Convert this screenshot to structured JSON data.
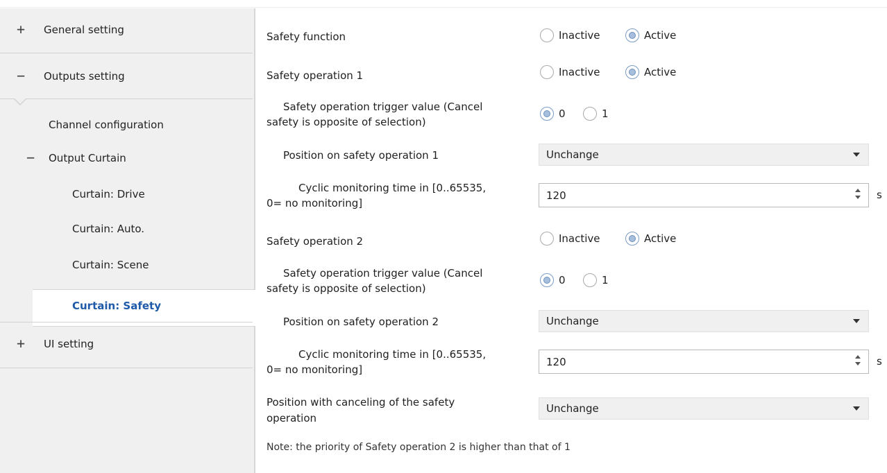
{
  "sidebar": {
    "items": [
      {
        "sign": "+",
        "label": "General setting"
      },
      {
        "sign": "−",
        "label": "Outputs setting"
      },
      {
        "label": "Channel configuration"
      },
      {
        "sign": "−",
        "label": "Output Curtain"
      },
      {
        "label": "Curtain: Drive"
      },
      {
        "label": "Curtain: Auto."
      },
      {
        "label": "Curtain: Scene"
      },
      {
        "label": "Curtain: Safety"
      },
      {
        "sign": "+",
        "label": "UI setting"
      }
    ]
  },
  "params": {
    "safety_function": {
      "label": "Safety function",
      "opt1": "Inactive",
      "opt2": "Active",
      "selected": "Active"
    },
    "safety_op1": {
      "label": "Safety operation 1",
      "opt1": "Inactive",
      "opt2": "Active",
      "selected": "Active"
    },
    "trigger1": {
      "label_line1": "Safety operation trigger value (Cancel",
      "label_line2": "safety is opposite of  selection)",
      "opt1": "0",
      "opt2": "1",
      "selected": "0"
    },
    "position1": {
      "label": "Position on safety operation 1",
      "value": "Unchange"
    },
    "monitor1": {
      "label_line1": "Cyclic monitoring time in [0..65535,",
      "label_line2": "0= no monitoring]",
      "value": "120",
      "unit": "s"
    },
    "safety_op2": {
      "label": "Safety operation 2",
      "opt1": "Inactive",
      "opt2": "Active",
      "selected": "Active"
    },
    "trigger2": {
      "label_line1": "Safety operation trigger value (Cancel",
      "label_line2": "safety is opposite of  selection)",
      "opt1": "0",
      "opt2": "1",
      "selected": "0"
    },
    "position2": {
      "label": "Position on safety operation 2",
      "value": "Unchange"
    },
    "monitor2": {
      "label_line1": "Cyclic monitoring time in [0..65535,",
      "label_line2": "0= no monitoring]",
      "value": "120",
      "unit": "s"
    },
    "cancel_position": {
      "label_line1": "Position with canceling of the safety",
      "label_line2": "operation",
      "value": "Unchange"
    }
  },
  "note": "Note: the priority of Safety operation 2 is higher than that of 1"
}
